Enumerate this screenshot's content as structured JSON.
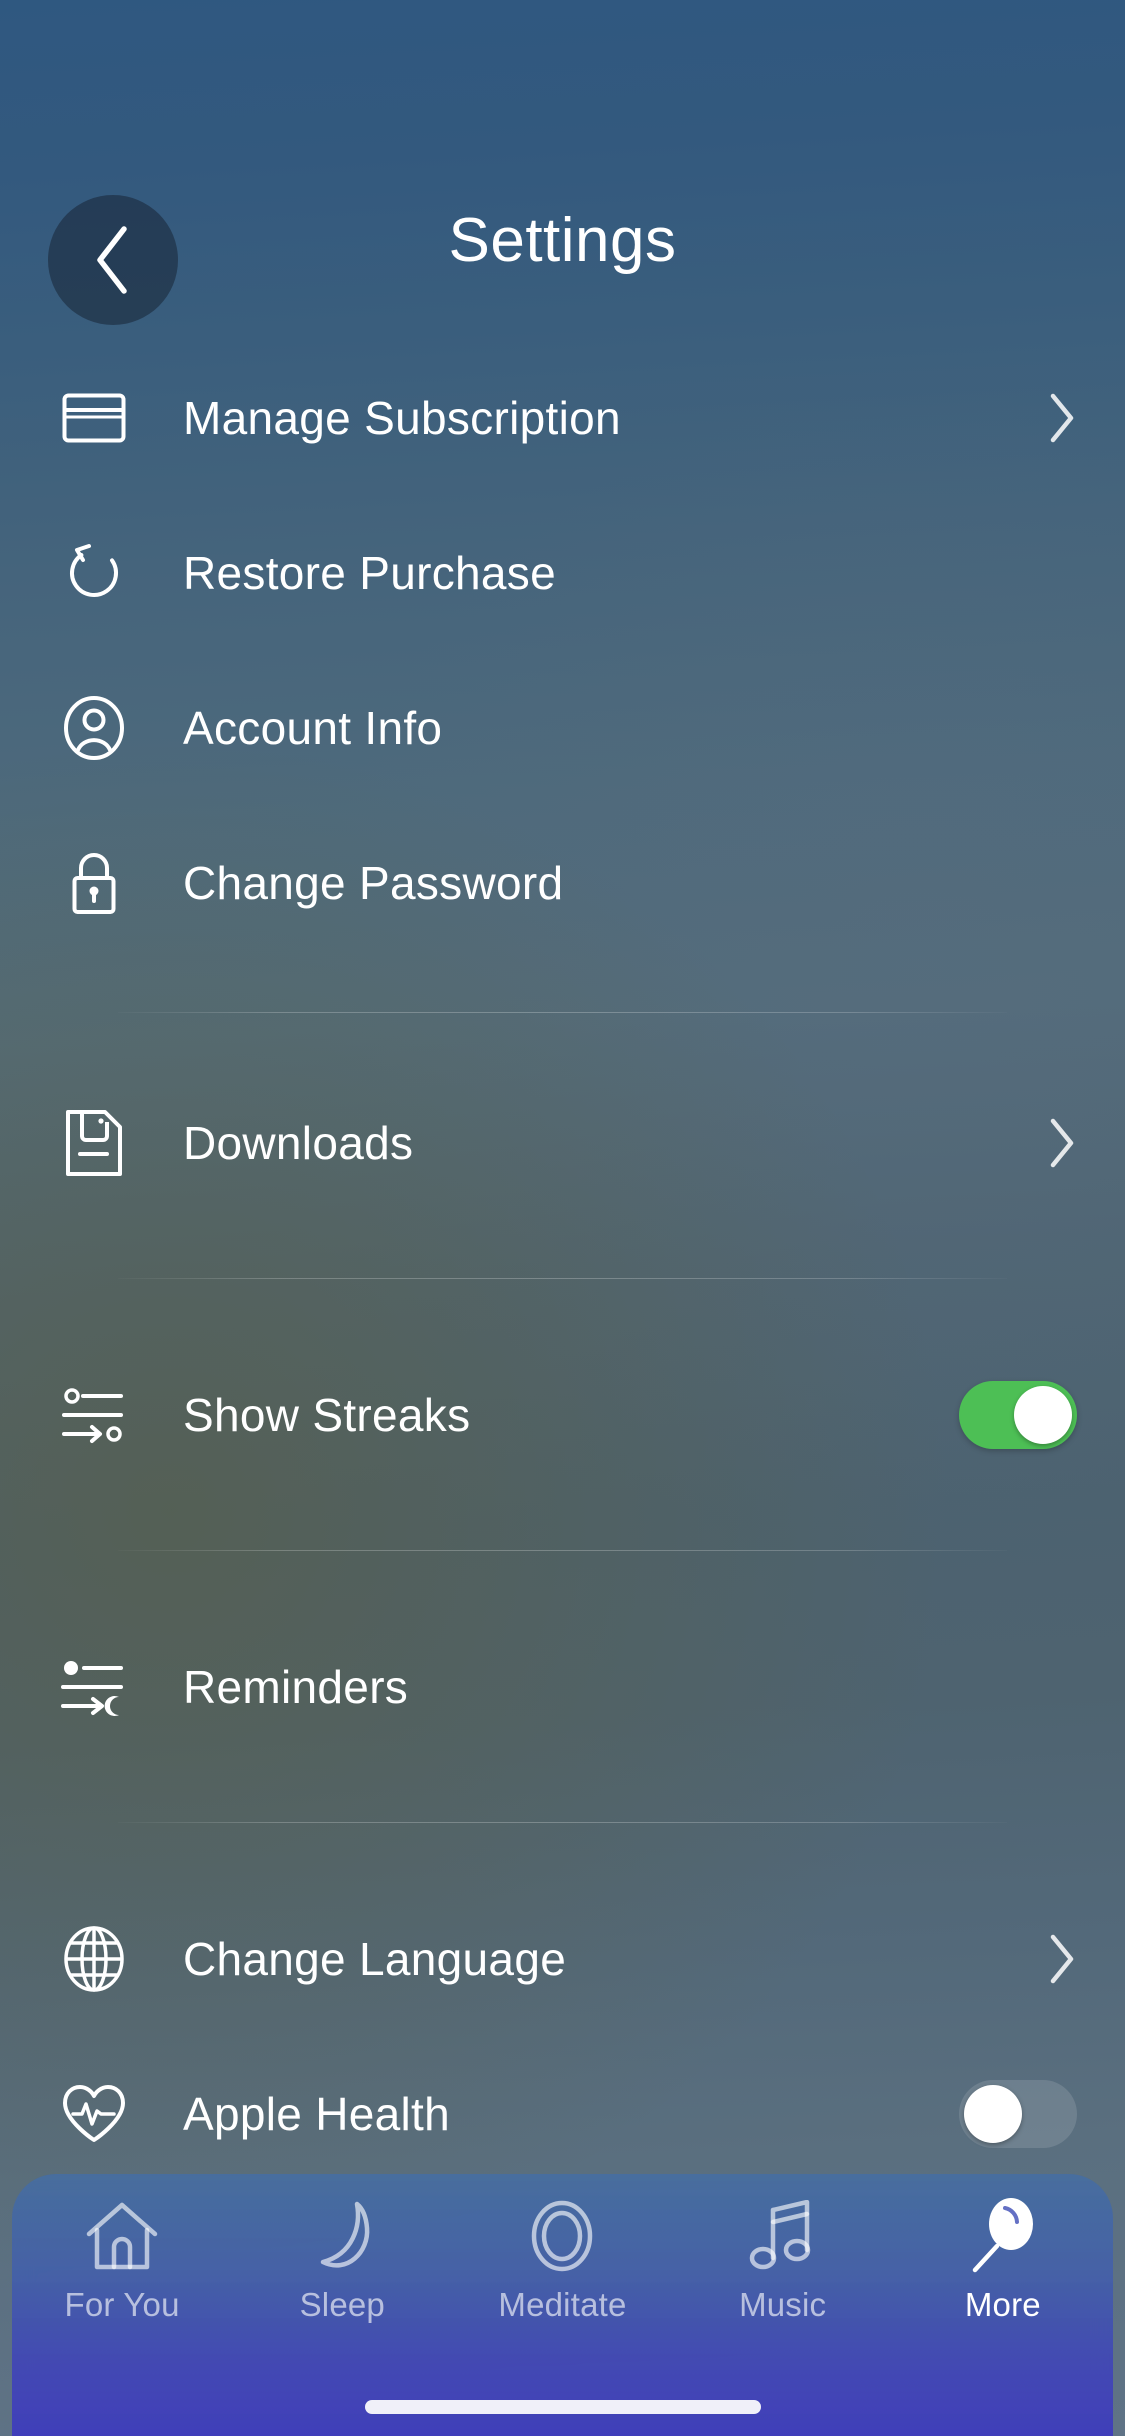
{
  "header": {
    "title": "Settings",
    "back_icon": "chevron-left-icon"
  },
  "settings_groups": [
    {
      "id": "account",
      "rows": [
        {
          "id": "manage-subscription",
          "label": "Manage Subscription",
          "icon": "credit-card-icon",
          "accessory": "chevron"
        },
        {
          "id": "restore-purchase",
          "label": "Restore Purchase",
          "icon": "restore-arrow-icon",
          "accessory": "none"
        },
        {
          "id": "account-info",
          "label": "Account Info",
          "icon": "user-circle-icon",
          "accessory": "none"
        },
        {
          "id": "change-password",
          "label": "Change Password",
          "icon": "lock-icon",
          "accessory": "none"
        }
      ]
    },
    {
      "id": "downloads",
      "rows": [
        {
          "id": "downloads",
          "label": "Downloads",
          "icon": "document-save-icon",
          "accessory": "chevron"
        }
      ]
    },
    {
      "id": "streaks",
      "rows": [
        {
          "id": "show-streaks",
          "label": "Show Streaks",
          "icon": "sliders-icon",
          "accessory": "toggle",
          "toggle_state": "on"
        }
      ]
    },
    {
      "id": "reminders",
      "rows": [
        {
          "id": "reminders",
          "label": "Reminders",
          "icon": "sliders-moon-icon",
          "accessory": "none"
        }
      ]
    },
    {
      "id": "locale-health",
      "rows": [
        {
          "id": "change-language",
          "label": "Change Language",
          "icon": "globe-icon",
          "accessory": "chevron"
        },
        {
          "id": "apple-health",
          "label": "Apple Health",
          "icon": "heart-pulse-icon",
          "accessory": "toggle",
          "toggle_state": "off"
        }
      ]
    }
  ],
  "tabbar": {
    "tabs": [
      {
        "id": "for-you",
        "label": "For You",
        "icon": "home-icon",
        "active": false
      },
      {
        "id": "sleep",
        "label": "Sleep",
        "icon": "moon-icon",
        "active": false
      },
      {
        "id": "meditate",
        "label": "Meditate",
        "icon": "ring-icon",
        "active": false
      },
      {
        "id": "music",
        "label": "Music",
        "icon": "music-note-icon",
        "active": false
      },
      {
        "id": "more",
        "label": "More",
        "icon": "balloon-icon",
        "active": true
      }
    ]
  },
  "colors": {
    "toggle_on": "#4dbf55",
    "knob": "#ffffff",
    "text": "#ffffff",
    "tab_inactive": "rgba(255,255,255,0.62)"
  }
}
